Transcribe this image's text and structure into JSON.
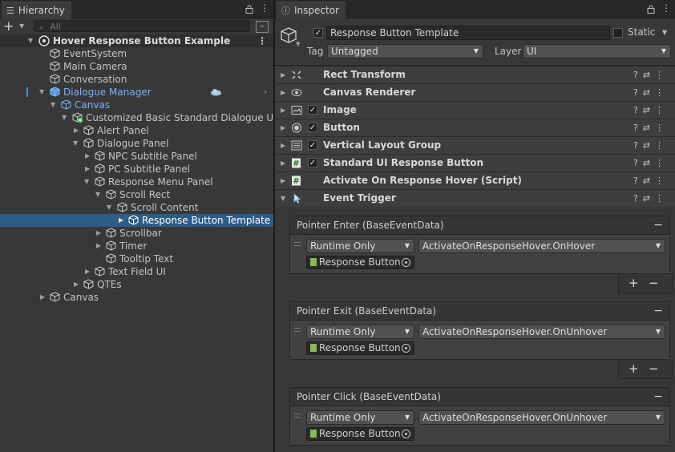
{
  "hierarchy": {
    "tab_label": "Hierarchy",
    "search_placeholder": "All",
    "add_label": "+",
    "scene": "Hover Response Button Example",
    "items": [
      {
        "label": "EventSystem"
      },
      {
        "label": "Main Camera"
      },
      {
        "label": "Conversation"
      },
      {
        "label": "Dialogue Manager"
      },
      {
        "label": "Canvas"
      },
      {
        "label": "Customized Basic Standard Dialogue UI"
      },
      {
        "label": "Alert Panel"
      },
      {
        "label": "Dialogue Panel"
      },
      {
        "label": "NPC Subtitle Panel"
      },
      {
        "label": "PC Subtitle Panel"
      },
      {
        "label": "Response Menu Panel"
      },
      {
        "label": "Scroll Rect"
      },
      {
        "label": "Scroll Content"
      },
      {
        "label": "Response Button Template"
      },
      {
        "label": "Scrollbar"
      },
      {
        "label": "Timer"
      },
      {
        "label": "Tooltip Text"
      },
      {
        "label": "Text Field UI"
      },
      {
        "label": "QTEs"
      },
      {
        "label": "Canvas"
      }
    ]
  },
  "inspector": {
    "tab_label": "Inspector",
    "object_name": "Response Button Template",
    "static_label": "Static",
    "tag_label": "Tag",
    "tag_value": "Untagged",
    "layer_label": "Layer",
    "layer_value": "UI",
    "components": [
      {
        "name": "Rect Transform",
        "icon": "rect-transform-icon"
      },
      {
        "name": "Canvas Renderer",
        "icon": "eye-icon"
      },
      {
        "name": "Image",
        "icon": "image-icon"
      },
      {
        "name": "Button",
        "icon": "button-icon"
      },
      {
        "name": "Vertical Layout Group",
        "icon": "layout-icon"
      },
      {
        "name": "Standard UI Response Button",
        "icon": "script-icon"
      },
      {
        "name": "Activate On Response Hover (Script)",
        "icon": "script-icon"
      },
      {
        "name": "Event Trigger",
        "icon": "event-trigger-icon"
      }
    ],
    "events": [
      {
        "header": "Pointer Enter (BaseEventData)",
        "mode": "Runtime Only",
        "function": "ActivateOnResponseHover.OnHover",
        "object": "Response Button Template"
      },
      {
        "header": "Pointer Exit (BaseEventData)",
        "mode": "Runtime Only",
        "function": "ActivateOnResponseHover.OnUnhover",
        "object": "Response Button Template"
      },
      {
        "header": "Pointer Click (BaseEventData)",
        "mode": "Runtime Only",
        "function": "ActivateOnResponseHover.OnUnhover",
        "object": "Response Button Template"
      }
    ]
  },
  "colors": {
    "selection": "#2c5d87",
    "prefab_blue": "#7bb0ff",
    "panel_bg": "#383838"
  }
}
